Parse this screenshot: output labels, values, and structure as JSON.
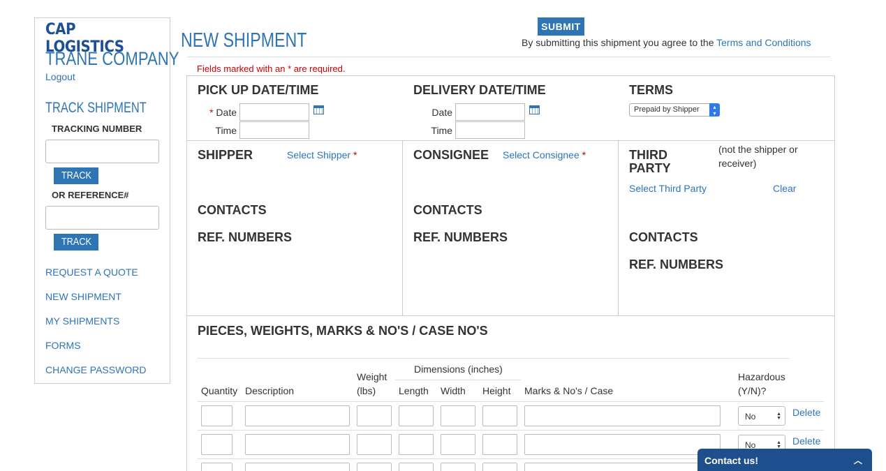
{
  "sidebar": {
    "logo": "CAP LOGISTICS",
    "company": "TRANE COMPANY",
    "logout": "Logout",
    "track_title": "TRACK SHIPMENT",
    "tracking_label": "TRACKING NUMBER",
    "track_button": "TRACK",
    "reference_label": "OR REFERENCE#",
    "links": [
      "REQUEST A QUOTE",
      "NEW SHIPMENT",
      "MY SHIPMENTS",
      "FORMS",
      "CHANGE PASSWORD"
    ]
  },
  "header": {
    "title": "NEW SHIPMENT",
    "submit": "SUBMIT",
    "agree_text": "By submitting this shipment you agree to the",
    "terms_link": "Terms and Conditions",
    "required_note_a": "Fields marked with an",
    "required_star": "*",
    "required_note_b": "are required."
  },
  "dates": {
    "pickup_title": "PICK UP DATE/TIME",
    "delivery_title": "DELIVERY DATE/TIME",
    "terms_title": "TERMS",
    "date_label": "Date",
    "time_label": "Time",
    "terms_value": "Prepaid by Shipper"
  },
  "parties": {
    "shipper_title": "SHIPPER",
    "select_shipper": "Select Shipper",
    "consignee_title": "CONSIGNEE",
    "select_consignee": "Select Consignee",
    "third_party_title_1": "THIRD",
    "third_party_title_2": "PARTY",
    "third_party_note": "(not the shipper or receiver)",
    "select_third_party": "Select Third Party",
    "clear": "Clear",
    "contacts": "CONTACTS",
    "ref_numbers": "REF. NUMBERS"
  },
  "pieces": {
    "title": "PIECES, WEIGHTS, MARKS & NO'S / CASE NO'S",
    "dimensions_label": "Dimensions (inches)",
    "columns": {
      "quantity": "Quantity",
      "description": "Description",
      "weight_1": "Weight",
      "weight_2": "(lbs)",
      "length": "Length",
      "width": "Width",
      "height": "Height",
      "marks": "Marks & No's / Case",
      "hazardous_1": "Hazardous",
      "hazardous_2": "(Y/N)?"
    },
    "rows": [
      {
        "hazardous": "No",
        "action": "Delete"
      },
      {
        "hazardous": "No",
        "action": "Delete"
      }
    ]
  },
  "contact_widget": {
    "label": "Contact us!"
  },
  "colors": {
    "brand_blue": "#2e75b6",
    "dark_blue": "#1c4f8c",
    "required_red": "#cc0000"
  }
}
